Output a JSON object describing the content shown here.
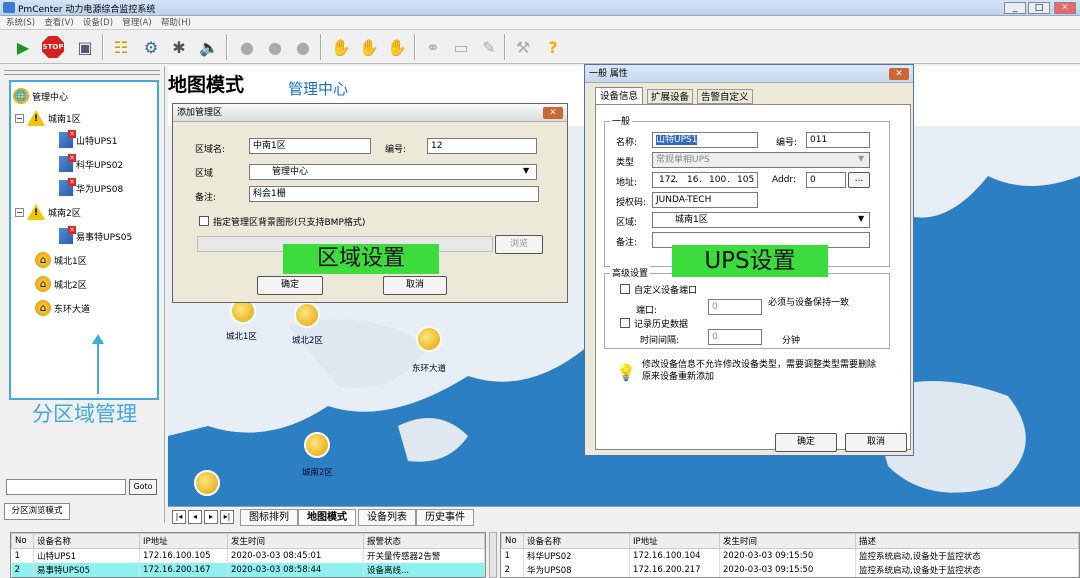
{
  "window": {
    "title": "PmCenter 动力电源综合监控系统"
  },
  "menu": [
    "系统(S)",
    "查看(V)",
    "设备(D)",
    "管理(A)",
    "帮助(H)"
  ],
  "left": {
    "tree_root": "管理中心",
    "zone1": "城南1区",
    "ups1": "山特UPS1",
    "ups2": "科华UPS02",
    "ups3": "华为UPS08",
    "zone2": "城南2区",
    "ups4": "易事特UPS05",
    "zone3": "城北1区",
    "zone4": "城北2区",
    "zone5": "东环大道",
    "caption": "分区域管理",
    "goto_label": "Goto",
    "mode_tab": "分区浏览模式"
  },
  "map": {
    "title": "地图模式",
    "subtitle": "管理中心",
    "labels": [
      "城北1区",
      "城北2区",
      "东环大道",
      "城南2区"
    ]
  },
  "dlg1": {
    "title": "添加管理区",
    "name_label": "区域名:",
    "name_value": "中南1区",
    "num_label": "编号:",
    "num_value": "12",
    "area_label": "区域",
    "area_value": "管理中心",
    "note_label": "备注:",
    "note_value": "科会1栅",
    "bg_check": "指定管理区背景图形(只支持BMP格式)",
    "browse": "浏览",
    "ok": "确定",
    "cancel": "取消",
    "overlay": "区域设置"
  },
  "dlg2": {
    "title": "一般 属性",
    "tabs": [
      "设备信息",
      "扩展设备",
      "告警自定义"
    ],
    "group1": "一般",
    "name_label": "名称:",
    "name_value": "山特UPS1",
    "num_label": "编号:",
    "num_value": "011",
    "type_label": "类型",
    "type_value": "常规单相UPS",
    "addr_label": "地址:",
    "ip1": "172",
    "ip2": "16",
    "ip3": "100",
    "ip4": "105",
    "addr2_label": "Addr:",
    "addr2_value": "0",
    "auth_label": "授权码:",
    "auth_value": "JUNDA-TECH",
    "area_label": "区域:",
    "area_value": "城南1区",
    "note_label": "备注:",
    "group2": "高级设置",
    "port_check": "自定义设备端口",
    "port_label": "端口:",
    "port_value": "0",
    "port_hint": "必须与设备保持一致",
    "hist_check": "记录历史数据",
    "interval_label": "时间间隔:",
    "interval_value": "0",
    "interval_unit": "分钟",
    "warn": "修改设备信息不允许修改设备类型，需要调整类型需要删除原来设备重新添加",
    "ok": "确定",
    "cancel": "取消",
    "overlay": "UPS设置"
  },
  "tabs": [
    "图标排列",
    "地图模式",
    "设备列表",
    "历史事件"
  ],
  "grid_left": {
    "headers": [
      "No",
      "设备名称",
      "IP地址",
      "发生时间",
      "报警状态"
    ],
    "rows": [
      [
        "1",
        "山特UPS1",
        "172.16.100.105",
        "2020-03-03 08:45:01",
        "开关量传感器2告警"
      ],
      [
        "2",
        "易事特UPS05",
        "172.16.200.167",
        "2020-03-03 08:58:44",
        "设备离线..."
      ]
    ]
  },
  "grid_right": {
    "headers": [
      "No",
      "设备名称",
      "IP地址",
      "发生时间",
      "描述"
    ],
    "rows": [
      [
        "1",
        "科华UPS02",
        "172.16.100.104",
        "2020-03-03 09:15:50",
        "监控系统启动,设备处于监控状态"
      ],
      [
        "2",
        "华为UPS08",
        "172.16.200.217",
        "2020-03-03 09:15:50",
        "监控系统启动,设备处于监控状态"
      ]
    ]
  },
  "colors": {
    "accent": "#41a8e0",
    "overlay": "#3bdc3b",
    "map_sea": "#2d7fc4",
    "selected_row": "#8ff0f0"
  }
}
